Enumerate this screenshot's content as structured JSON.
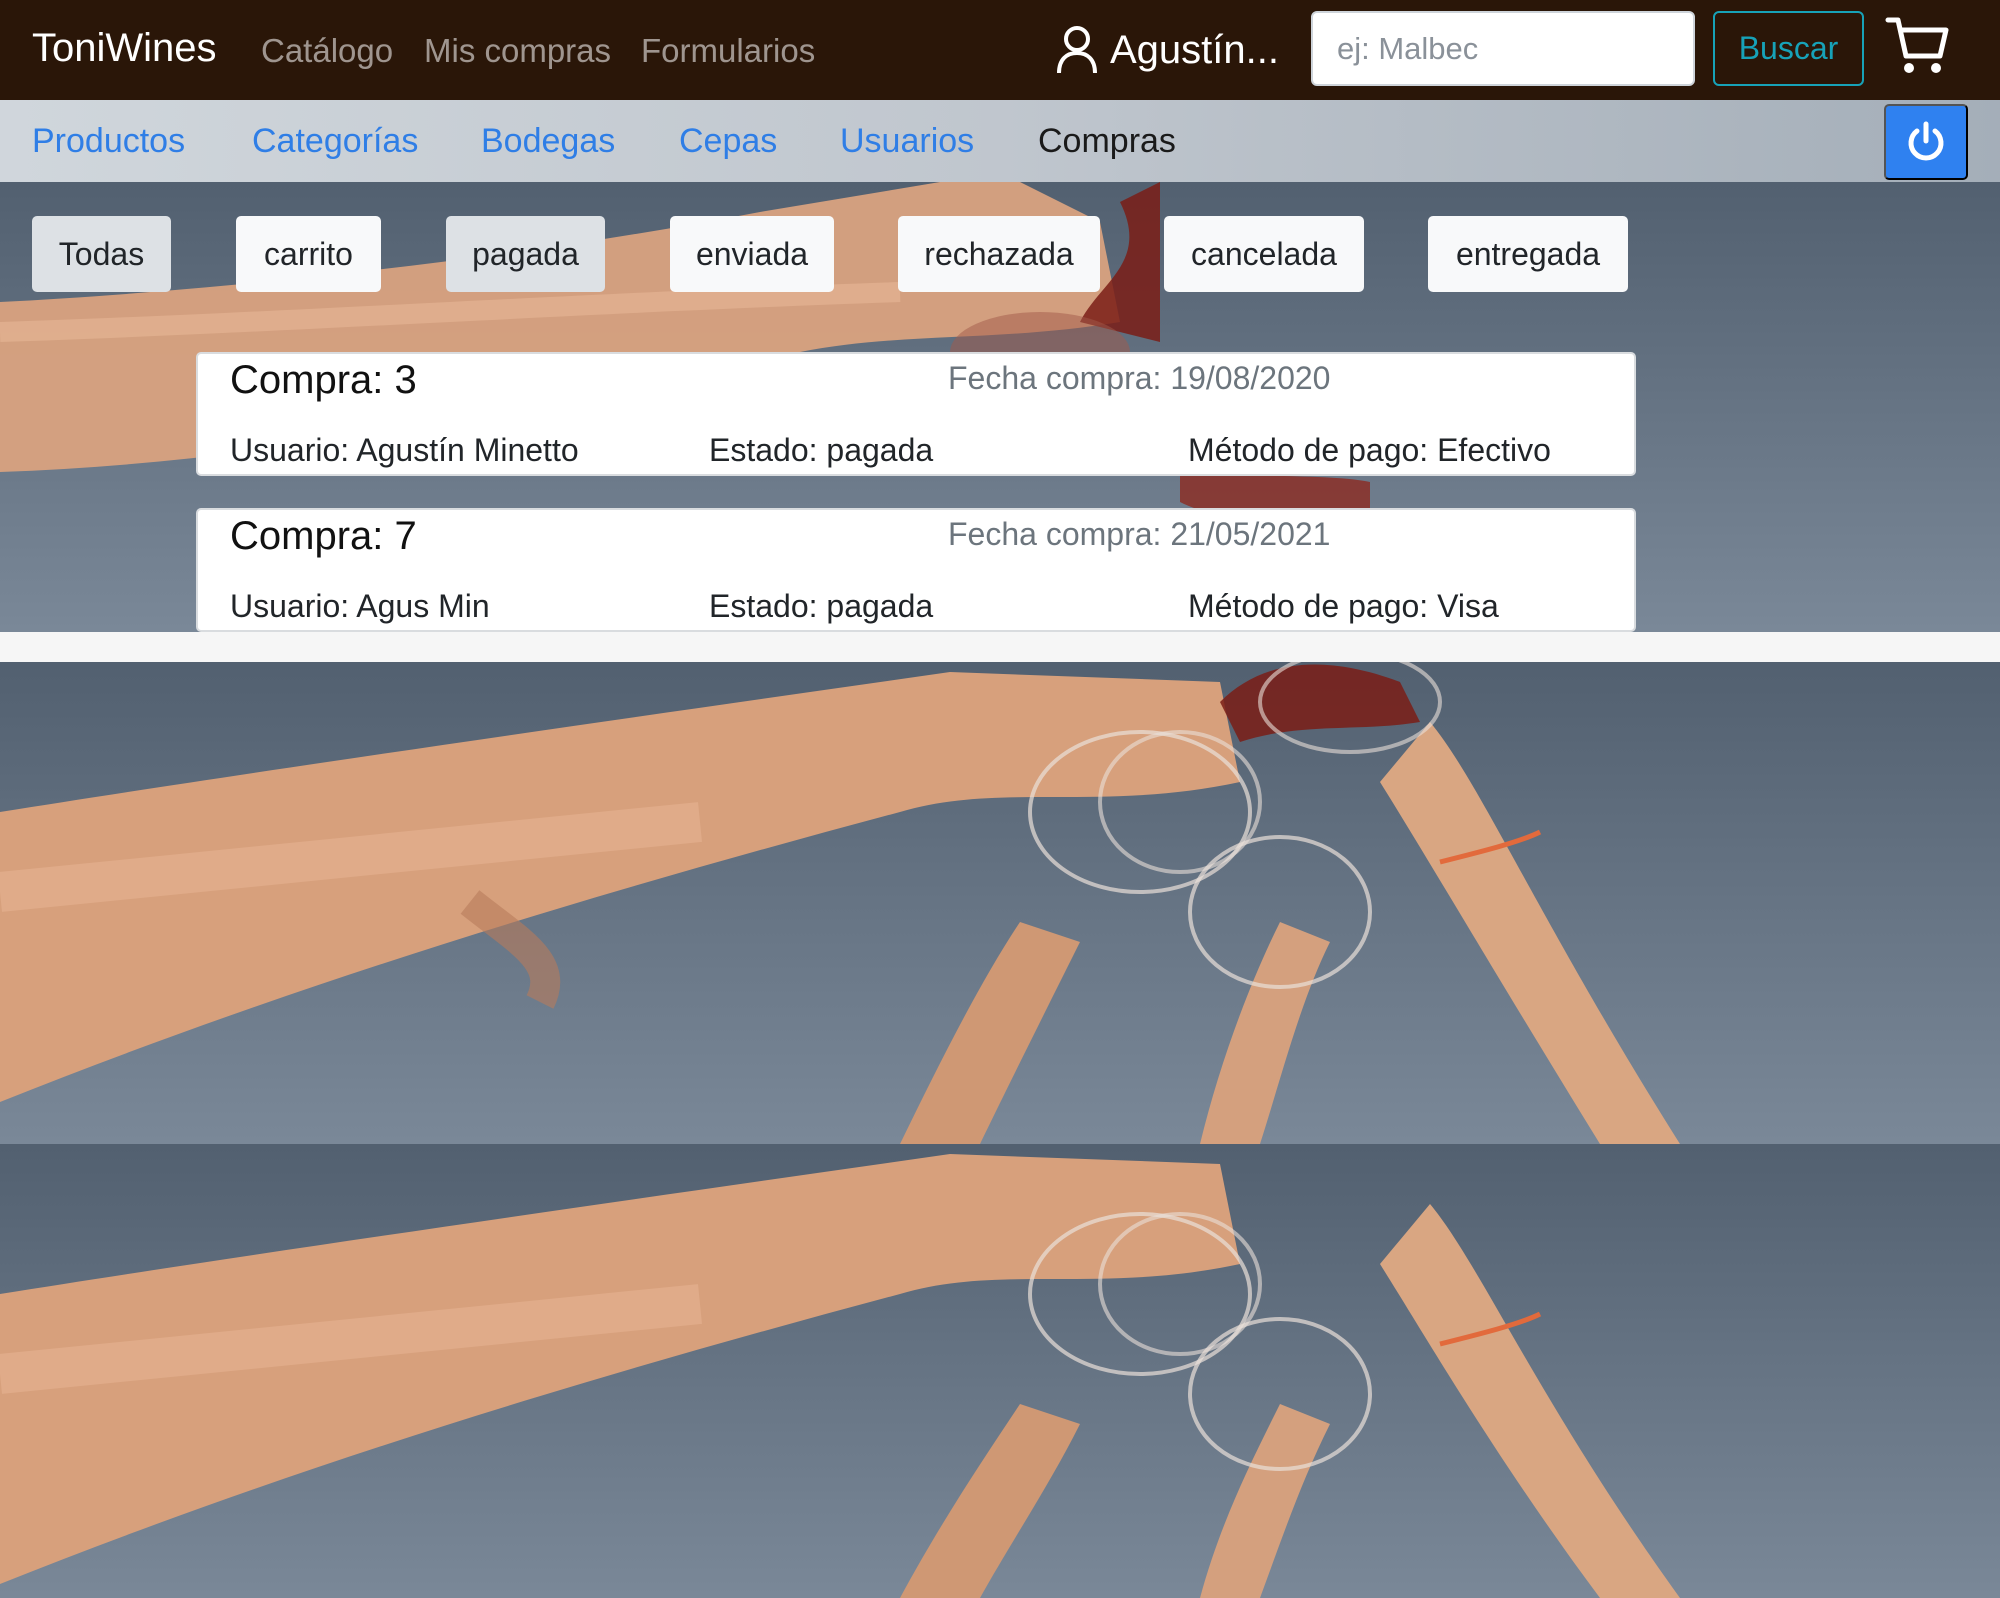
{
  "navbar": {
    "brand": "ToniWines",
    "links": [
      "Catálogo",
      "Mis compras",
      "Formularios"
    ],
    "user_name": "Agustín...",
    "search_placeholder": "ej: Malbec",
    "search_button": "Buscar",
    "icons": {
      "user": "user-icon",
      "cart": "cart-icon"
    }
  },
  "admin_nav": {
    "links": [
      "Productos",
      "Categorías",
      "Bodegas",
      "Cepas",
      "Usuarios",
      "Compras"
    ],
    "active": "Compras",
    "logout_icon": "power-icon",
    "accent_color": "#2f81f0"
  },
  "filters": {
    "items": [
      "Todas",
      "carrito",
      "pagada",
      "enviada",
      "rechazada",
      "cancelada",
      "entregada"
    ],
    "selected": [
      "Todas",
      "pagada"
    ]
  },
  "purchases": [
    {
      "title": "Compra: 3",
      "date": "Fecha compra: 19/08/2020",
      "user": "Usuario: Agustín Minetto",
      "state": "Estado: pagada",
      "payment": "Método de pago: Efectivo"
    },
    {
      "title": "Compra: 7",
      "date": "Fecha compra: 21/05/2021",
      "user": "Usuario: Agus Min",
      "state": "Estado: pagada",
      "payment": "Método de pago: Visa"
    }
  ],
  "colors": {
    "navbar_bg": "#2a1608",
    "link_blue": "#2f7ee6",
    "search_button": "#17a2b8"
  }
}
